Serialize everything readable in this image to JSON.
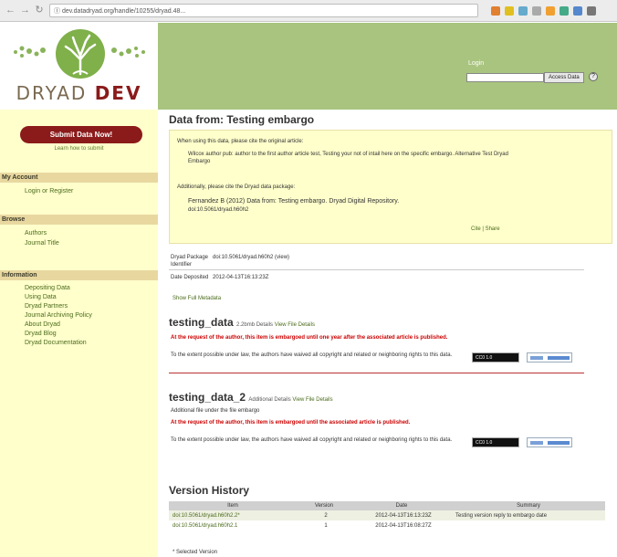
{
  "browser": {
    "url": "datadryad.org/handle/10255/dryad.48000",
    "url_display": "Ⓘ dev.datadryad.org/handle/10255/dryad.48..."
  },
  "header": {
    "logo_text_a": "DRYAD",
    "logo_text_b": "DEV",
    "login_label": "Login",
    "login_button": "Access Data",
    "help_icon": "?"
  },
  "sidebar": {
    "submit_button": "Submit Data Now!",
    "learn_link": "Learn how to submit",
    "sections": [
      {
        "title": "My Account",
        "items": [
          "Login or Register"
        ]
      },
      {
        "title": "Browse",
        "items": [
          "Authors",
          "Journal Title"
        ]
      },
      {
        "title": "Information",
        "items": [
          "Depositing Data",
          "Using Data",
          "Dryad Partners",
          "Journal Archiving Policy",
          "About Dryad",
          "Dryad Blog",
          "Dryad Documentation"
        ]
      }
    ]
  },
  "main": {
    "title": "Data from: Testing embargo",
    "citation": {
      "intro": "When using this data, please cite the original article:",
      "article": "Wilcox author pub: author to the first author article test, Testing your not of intail here on the specific embargo. Alternative Test Dryad Embargo",
      "additional": "Additionally, please cite the Dryad data package:",
      "package": "Fernandez B (2012) Data from: Testing embargo. Dryad Digital Repository.",
      "doi": "doi:10.5061/dryad.h60h2",
      "cite_links": "Cite | Share"
    },
    "meta": [
      {
        "key": "Dryad Package Identifier",
        "value": "doi:10.5061/dryad.h60h2 (view)"
      },
      {
        "key": "Date Deposited",
        "value": "2012-04-13T16:13:23Z"
      }
    ],
    "show_metadata": "Show Full Metadata",
    "file1": {
      "title": "testing_data",
      "details": "2.2bmb Details",
      "details_link": "View File Details",
      "embargo": "At the request of the author, this item is embargoed until one year after the associated article is published.",
      "cc0": "To the extent possible under law, the authors have waived all copyright and related or neighboring rights to this data.",
      "badge": "CC0 1.0"
    },
    "file2": {
      "title": "testing_data_2",
      "details": "Additional Details",
      "details_link": "View File Details",
      "subline": "Additional file under the file embargo",
      "embargo": "At the request of the author, this item is embargoed until the associated article is published.",
      "cc0": "To the extent possible under law, the authors have waived all copyright and related or neighboring rights to this data.",
      "badge": "CC0 1.0"
    },
    "version_history": {
      "title": "Version History",
      "columns": [
        "Item",
        "Version",
        "Date",
        "Summary"
      ],
      "rows": [
        {
          "item": "doi:10.5061/dryad.h60h2.2*",
          "version": "2",
          "date": "2012-04-13T16:13:23Z",
          "summary": "Testing version reply to embargo date"
        },
        {
          "item": "doi:10.5061/dryad.h60h2.1",
          "version": "1",
          "date": "2012-04-13T16:08:27Z",
          "summary": ""
        }
      ],
      "note": "* Selected Version"
    }
  },
  "colors": {
    "header_green": "#a8c47e",
    "sidebar_yellow": "#ffffcc",
    "section_tan": "#e8d8a0",
    "submit_red": "#8b1a1a",
    "link_green": "#4a6a1a",
    "embargo_red": "#cc0000"
  },
  "icons": [
    "back-icon",
    "forward-icon",
    "reload-icon",
    "info-icon",
    "help-icon"
  ]
}
